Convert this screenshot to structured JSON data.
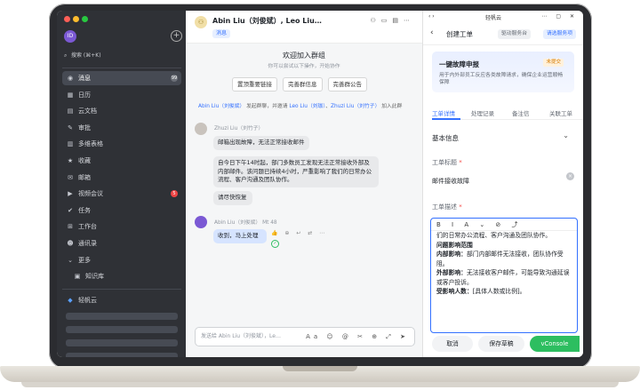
{
  "sidebar": {
    "avatar_initials": "ID",
    "search_placeholder": "搜索 (⌘+K)",
    "items": [
      {
        "label": "消息",
        "icon": "chat-icon",
        "badge": "99",
        "badge_style": "gray",
        "active": true
      },
      {
        "label": "日历",
        "icon": "calendar-icon"
      },
      {
        "label": "云文档",
        "icon": "doc-icon"
      },
      {
        "label": "审批",
        "icon": "approval-icon"
      },
      {
        "label": "多维表格",
        "icon": "table-icon"
      },
      {
        "label": "收藏",
        "icon": "star-icon"
      },
      {
        "label": "邮箱",
        "icon": "mail-icon"
      },
      {
        "label": "视频会议",
        "icon": "video-icon",
        "badge": "5",
        "badge_style": "red"
      },
      {
        "label": "任务",
        "icon": "task-icon"
      },
      {
        "label": "工作台",
        "icon": "workplace-icon"
      },
      {
        "label": "通讯录",
        "icon": "contacts-icon"
      },
      {
        "label": "更多",
        "icon": "more-icon"
      },
      {
        "label": "知识库",
        "icon": "wiki-icon"
      }
    ],
    "pinned_app": "轻帆云"
  },
  "chat": {
    "title": "Abin Liu（刘俊斌）, Leo Liu…",
    "tag": "消息",
    "welcome_title": "欢迎加入群组",
    "welcome_sub": "你可以尝试以下操作，开始协作",
    "actions": [
      "置顶重要链接",
      "完善群信息",
      "完善群公告"
    ],
    "system_line": {
      "p1": "Abin Liu（刘俊斌）",
      "p2": " 发起群聊，并邀请 ",
      "p3": "Leo Liu（刘珈）",
      "p4": "、",
      "p5": "Zhuzi Liu（刘竹子）",
      "p6": " 加入此群"
    },
    "messages": [
      {
        "sender": "Zhuzi Liu（刘竹子）",
        "bubbles": [
          "邮箱出现故障，无法正常接收邮件",
          "自今日下午14时起，部门多数员工发现无法正常接收外部及内部邮件。该问题已持续4小时，严重影响了我们的日常办公流程、客户沟通及团队协作。",
          "请尽快恢复"
        ]
      },
      {
        "sender": "Abin Liu（刘俊斌）",
        "time": "Mt 48",
        "bubbles": [
          "收到，马上处理"
        ],
        "reactions": "👍 ⊕ ↩ ⇄ ⋯"
      }
    ],
    "compose_placeholder": "发送给 Abin Liu（刘俊斌），Le…",
    "compose_tools": "Aa ☺ @ ✂ ⊕ ⤢ ➤"
  },
  "panel": {
    "top_title": "轻帆云",
    "nav_title": "创建工单",
    "nav_pill_left": "驱动服务台",
    "nav_pill_right": "请选服务项",
    "card_title": "一键故障申报",
    "card_tag": "未提交",
    "card_desc": "用于内外部员工反应各类故障请求，确保企业运营顺畅保障",
    "tabs": [
      "工单详情",
      "处理记录",
      "备注信",
      "关联工单"
    ],
    "section_title": "基本信息",
    "field_title_label": "工单标题",
    "field_title_value": "邮件接收故障",
    "field_desc_label": "工单描述",
    "toolbar": "B I A ⌄ ⊘ ⤴",
    "editor_lines": [
      {
        "kind": "text",
        "text": "们的日常办公流程、客户沟通及团队协作。"
      },
      {
        "kind": "bold",
        "text": "问题影响范围"
      },
      {
        "kind": "mixed",
        "b": "内部影响：",
        "t": "部门内部邮件无法接收，团队协作受阻。"
      },
      {
        "kind": "mixed",
        "b": "外部影响：",
        "t": "无法接收客户邮件，可能导致沟通延误或客户投诉。"
      },
      {
        "kind": "mixed",
        "b": "受影响人数：",
        "t": "[具体人数或比例]。"
      }
    ],
    "footer": {
      "cancel": "取消",
      "draft": "保存草稿",
      "submit": "vConsole"
    }
  }
}
